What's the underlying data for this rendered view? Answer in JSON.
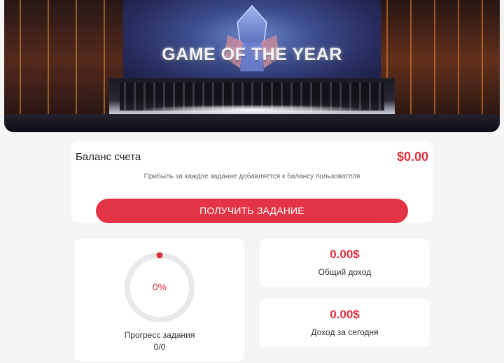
{
  "banner": {
    "title": "GAME OF THE YEAR"
  },
  "balance": {
    "label": "Баланс счета",
    "value": "$0.00",
    "note": "Прибыль за каждое задание добавляется к балансу пользователя",
    "button_label": "ПОЛУЧИТЬ ЗАДАНИЕ"
  },
  "progress": {
    "percent_text": "0%",
    "fraction": 0,
    "label": "Прогресс задания",
    "count": "0/0"
  },
  "stats": {
    "total": {
      "value": "0.00$",
      "label": "Общий доход"
    },
    "today": {
      "value": "0.00$",
      "label": "Доход за сегодня"
    }
  },
  "colors": {
    "accent": "#e23445",
    "background": "#f4f5f4",
    "ring_track": "#e9e9e9"
  }
}
